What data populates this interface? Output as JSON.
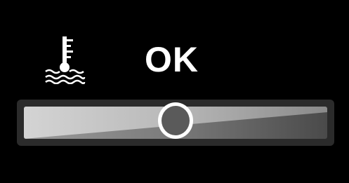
{
  "dashboard": {
    "coolant_icon": "coolant-temperature-icon",
    "status_text": "OK",
    "gauge": {
      "level_fraction": 0.5
    }
  },
  "colors": {
    "background": "#000000",
    "text": "#ffffff",
    "indicator_ring": "#ffffff"
  }
}
